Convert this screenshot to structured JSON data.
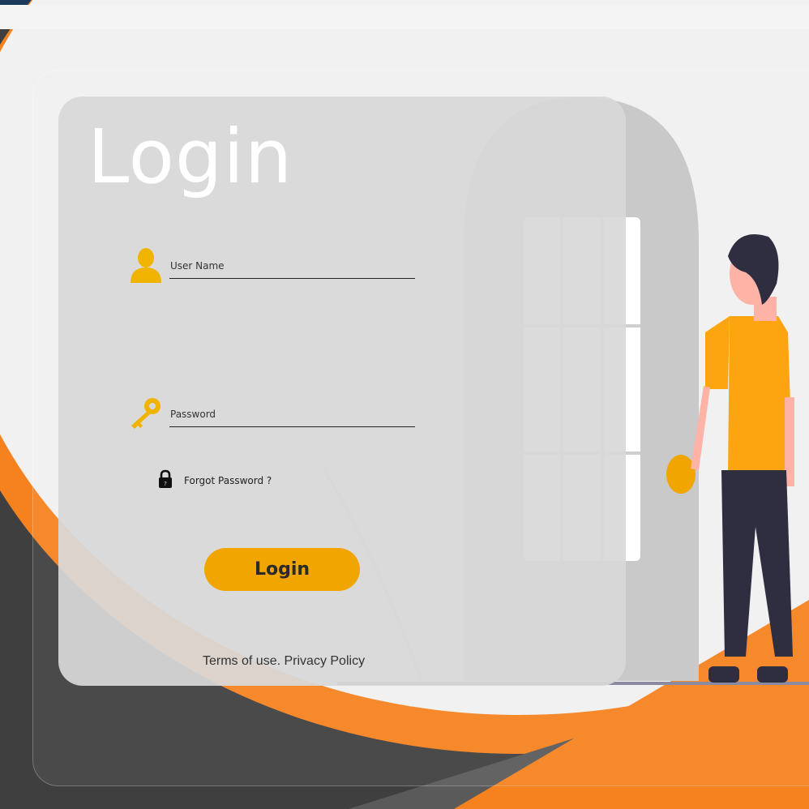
{
  "login": {
    "title": "Login",
    "username_label": "User Name",
    "password_label": "Password",
    "forgot_password": "Forgot Password ?",
    "submit_label": "Login",
    "terms_link": "Terms of use.",
    "privacy_link": "Privacy Policy"
  },
  "icons": {
    "user": "user-icon",
    "key": "key-icon",
    "lock": "lock-icon"
  },
  "colors": {
    "accent": "#f0a500",
    "orange": "#f5821f",
    "dark": "#3f3f3f",
    "card": "#d8d8d8"
  }
}
